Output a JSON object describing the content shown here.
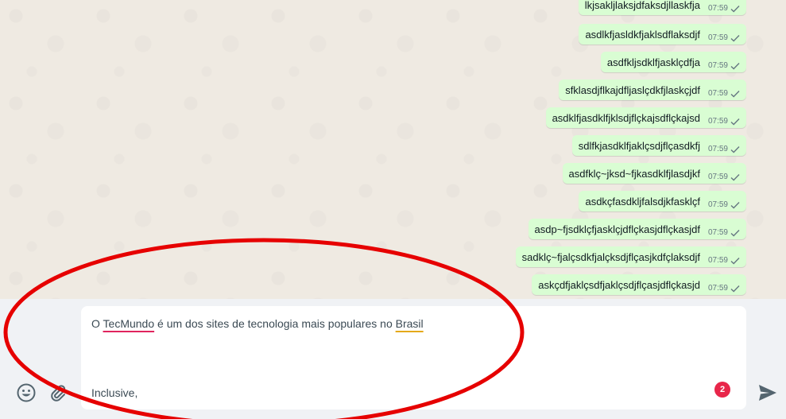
{
  "messages": [
    {
      "text": "lkjsakljlaksjdfaksdjllaskfja",
      "time": "07:59"
    },
    {
      "text": "asdlkfjasldkfjaklsdflaksdjf",
      "time": "07:59"
    },
    {
      "text": "asdfkljsdklfjasklçdfja",
      "time": "07:59"
    },
    {
      "text": "sfklasdjflkajdfljaslçdkfjlaskçjdf",
      "time": "07:59"
    },
    {
      "text": "asdklfjasdklfjklsdjflçkajsdflçkajsd",
      "time": "07:59"
    },
    {
      "text": "sdlfkjasdklfjaklçsdjflçasdkfj",
      "time": "07:59"
    },
    {
      "text": "asdfklç~jksd~fjkasdklfjlasdjkf",
      "time": "07:59"
    },
    {
      "text": "asdkçfasdkljfalsdjkfasklçf",
      "time": "07:59"
    },
    {
      "text": "asdp~fjsdklçfjasklçjdflçkasjdflçkasjdf",
      "time": "07:59"
    },
    {
      "text": "sadklç~fjalçsdkfjalçksdjflçasjkdfçlaksdjf",
      "time": "07:59"
    },
    {
      "text": "askçdfjaklçsdfjaklçsdjflçasjdflçkasjd",
      "time": "07:59"
    }
  ],
  "composer": {
    "line1": {
      "w1": "O ",
      "w2": "TecMundo",
      "w3": " é um dos sites de tecnologia mais populares no ",
      "w4": "Brasil"
    },
    "line2": "Inclusive,"
  },
  "counter_badge": "2",
  "icons": {
    "emoji": "emoji-icon",
    "attach": "paperclip-icon",
    "send": "send-icon",
    "check": "single-check-icon"
  },
  "colors": {
    "outgoing_bubble": "#d9fdd3",
    "chat_background": "#efeae2",
    "footer_background": "#f0f2f5",
    "badge": "#e8264a",
    "highlight_ellipse": "#e60000"
  }
}
